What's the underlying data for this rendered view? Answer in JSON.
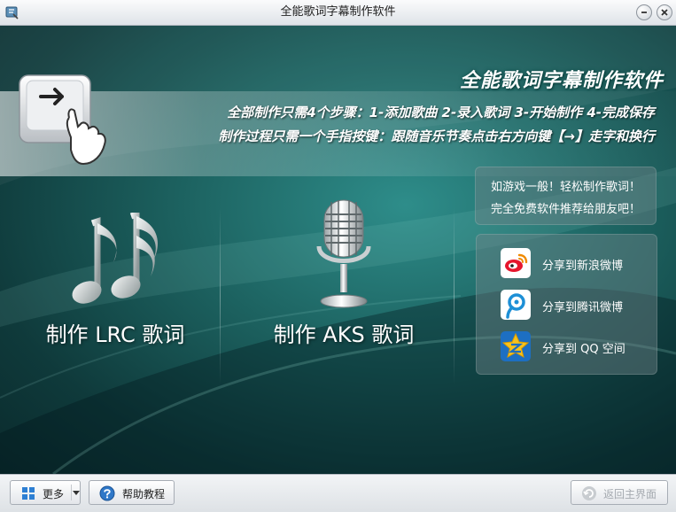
{
  "window": {
    "title": "全能歌词字幕制作软件"
  },
  "banner": {
    "brand_title": "全能歌词字幕制作软件",
    "steps_line": "全部制作只需4个步骤：1-添加歌曲  2-录入歌词  3-开始制作  4-完成保存",
    "tip_line": "制作过程只需一个手指按键：跟随音乐节奏点击右方向键【→】走字和换行"
  },
  "actions": {
    "lrc_label": "制作 LRC 歌词",
    "aks_label": "制作 AKS 歌词"
  },
  "promo": {
    "line1": "如游戏一般！轻松制作歌词！",
    "line2": "完全免费软件推荐给朋友吧！"
  },
  "share": [
    {
      "label": "分享到新浪微博",
      "icon": "sina-weibo-icon"
    },
    {
      "label": "分享到腾讯微博",
      "icon": "tencent-weibo-icon"
    },
    {
      "label": "分享到 QQ 空间",
      "icon": "qzone-icon"
    }
  ],
  "bottom": {
    "more_label": "更多",
    "help_label": "帮助教程",
    "home_label": "返回主界面",
    "home_enabled": false
  },
  "colors": {
    "background_teal": "#1c615f",
    "sina_red": "#e6162d",
    "tencent_blue": "#1d8fd6",
    "qzone_yellow": "#f7c21c"
  }
}
